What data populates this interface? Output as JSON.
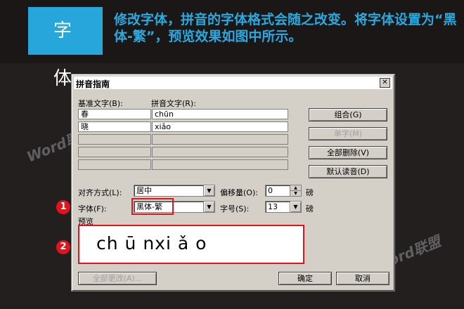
{
  "banner": {
    "tag": "字 体",
    "headline": "修改字体，拼音的字体格式会随之改变。将字体设置为“黑体-繁”，预览效果如图中所示。"
  },
  "dialog": {
    "title": "拼音指南",
    "close_icon": "✕",
    "base_text_label": "基准文字(B):",
    "pinyin_text_label": "拼音文字(R):",
    "rows": [
      {
        "base": "春",
        "pinyin": "chūn"
      },
      {
        "base": "晓",
        "pinyin": "xiǎo"
      },
      {
        "base": "",
        "pinyin": ""
      },
      {
        "base": "",
        "pinyin": ""
      },
      {
        "base": "",
        "pinyin": ""
      }
    ],
    "buttons": {
      "combine": "组合(G)",
      "single": "单字(M)",
      "delete_all": "全部删除(V)",
      "default_reading": "默认读音(D)",
      "change_all": "全部更改(A)...",
      "ok": "确定",
      "cancel": "取消"
    },
    "align_label": "对齐方式(L):",
    "align_value": "居中",
    "offset_label": "偏移量(O):",
    "offset_value": "0",
    "offset_unit": "磅",
    "font_label": "字体(F):",
    "font_value": "黑体-繁",
    "size_label": "字号(S):",
    "size_value": "13",
    "size_unit": "磅",
    "preview_label": "预览",
    "preview_text": "ch ū nxi ǎ o"
  },
  "markers": [
    "1",
    "2"
  ],
  "watermark": "Word联盟"
}
